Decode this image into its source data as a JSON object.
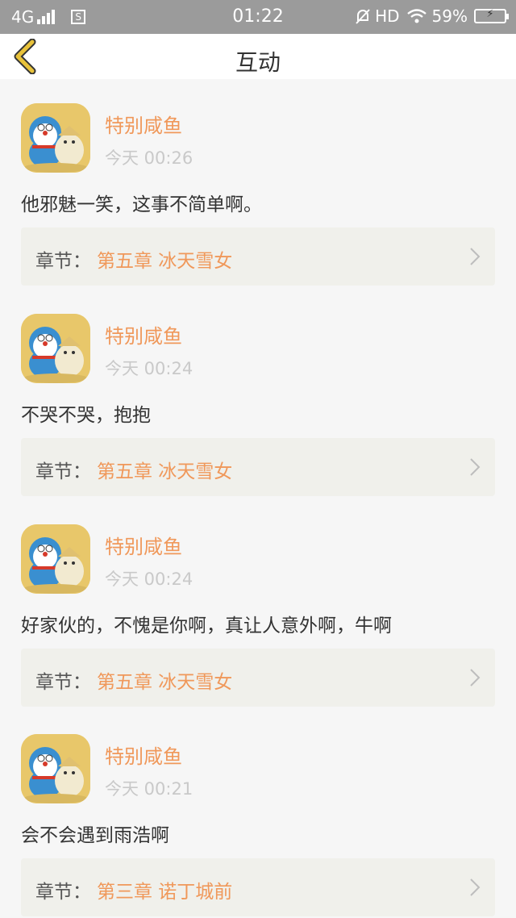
{
  "status": {
    "network": "4G",
    "sim_icon": "S",
    "time": "01:22",
    "hd": "HD",
    "battery": "59%"
  },
  "header": {
    "title": "互动"
  },
  "colors": {
    "accent": "#f0985a",
    "back_arrow": "#e8c23a",
    "chapter_bg": "#f0f0eb"
  },
  "items": [
    {
      "user": "特别咸鱼",
      "time": "今天 00:26",
      "text": "他邪魅一笑，这事不简单啊。",
      "chapter_label": "章节：",
      "chapter": "第五章 冰天雪女"
    },
    {
      "user": "特别咸鱼",
      "time": "今天 00:24",
      "text": "不哭不哭，抱抱",
      "chapter_label": "章节：",
      "chapter": "第五章 冰天雪女"
    },
    {
      "user": "特别咸鱼",
      "time": "今天 00:24",
      "text": "好家伙的，不愧是你啊，真让人意外啊，牛啊",
      "chapter_label": "章节：",
      "chapter": "第五章 冰天雪女"
    },
    {
      "user": "特别咸鱼",
      "time": "今天 00:21",
      "text": "会不会遇到雨浩啊",
      "chapter_label": "章节：",
      "chapter": "第三章 诺丁城前"
    }
  ]
}
